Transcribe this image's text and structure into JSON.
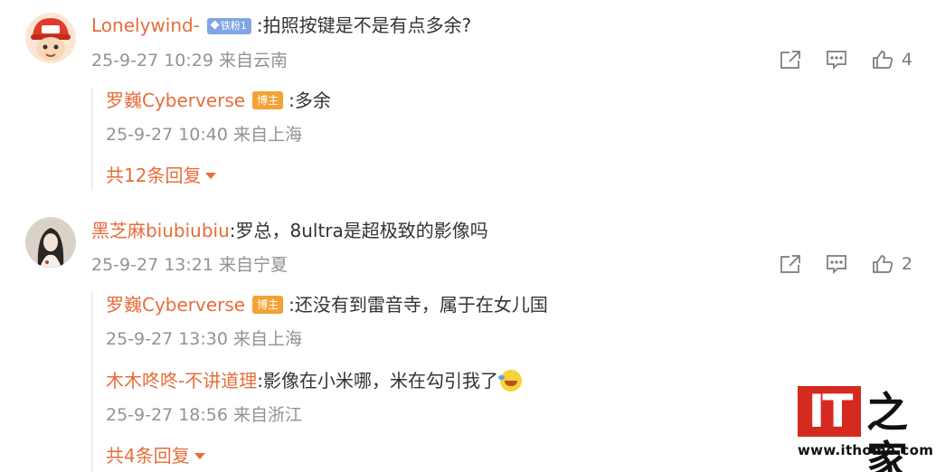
{
  "comments": [
    {
      "username": "Lonelywind-",
      "fan_badge": "铁粉1",
      "text": ":拍照按键是不是有点多余?",
      "meta": "25-9-27 10:29 来自云南",
      "like_count": "4",
      "replies": [
        {
          "username": "罗巍Cyberverse",
          "badge": "博主",
          "text": ":多余",
          "meta": "25-9-27 10:40 来自上海"
        }
      ],
      "more_replies": "共12条回复"
    },
    {
      "username": "黑芝麻biubiubiu",
      "text": ":罗总，8ultra是超极致的影像吗",
      "meta": "25-9-27 13:21 来自宁夏",
      "like_count": "2",
      "replies": [
        {
          "username": "罗巍Cyberverse",
          "badge": "博主",
          "text": ":还没有到雷音寺，属于在女儿国",
          "meta": "25-9-27 13:30 来自上海"
        },
        {
          "username": "木木咚咚-不讲道理",
          "text": ":影像在小米哪，米在勾引我了",
          "meta": "25-9-27 18:56 来自浙江",
          "emoji": "laugh-cry-emoji"
        }
      ],
      "more_replies": "共4条回复"
    }
  ],
  "watermark": {
    "logo_text": "IT",
    "logo_chinese": "之家",
    "url": "www.ithome.com"
  },
  "colors": {
    "username": "#e86c3a",
    "meta": "#939393",
    "host_badge": "#f4a236",
    "fan_badge": "#7ea6e6",
    "logo_red": "#d42a20"
  },
  "icons": [
    "share-icon",
    "comment-icon",
    "like-icon",
    "chevron-down-icon"
  ]
}
